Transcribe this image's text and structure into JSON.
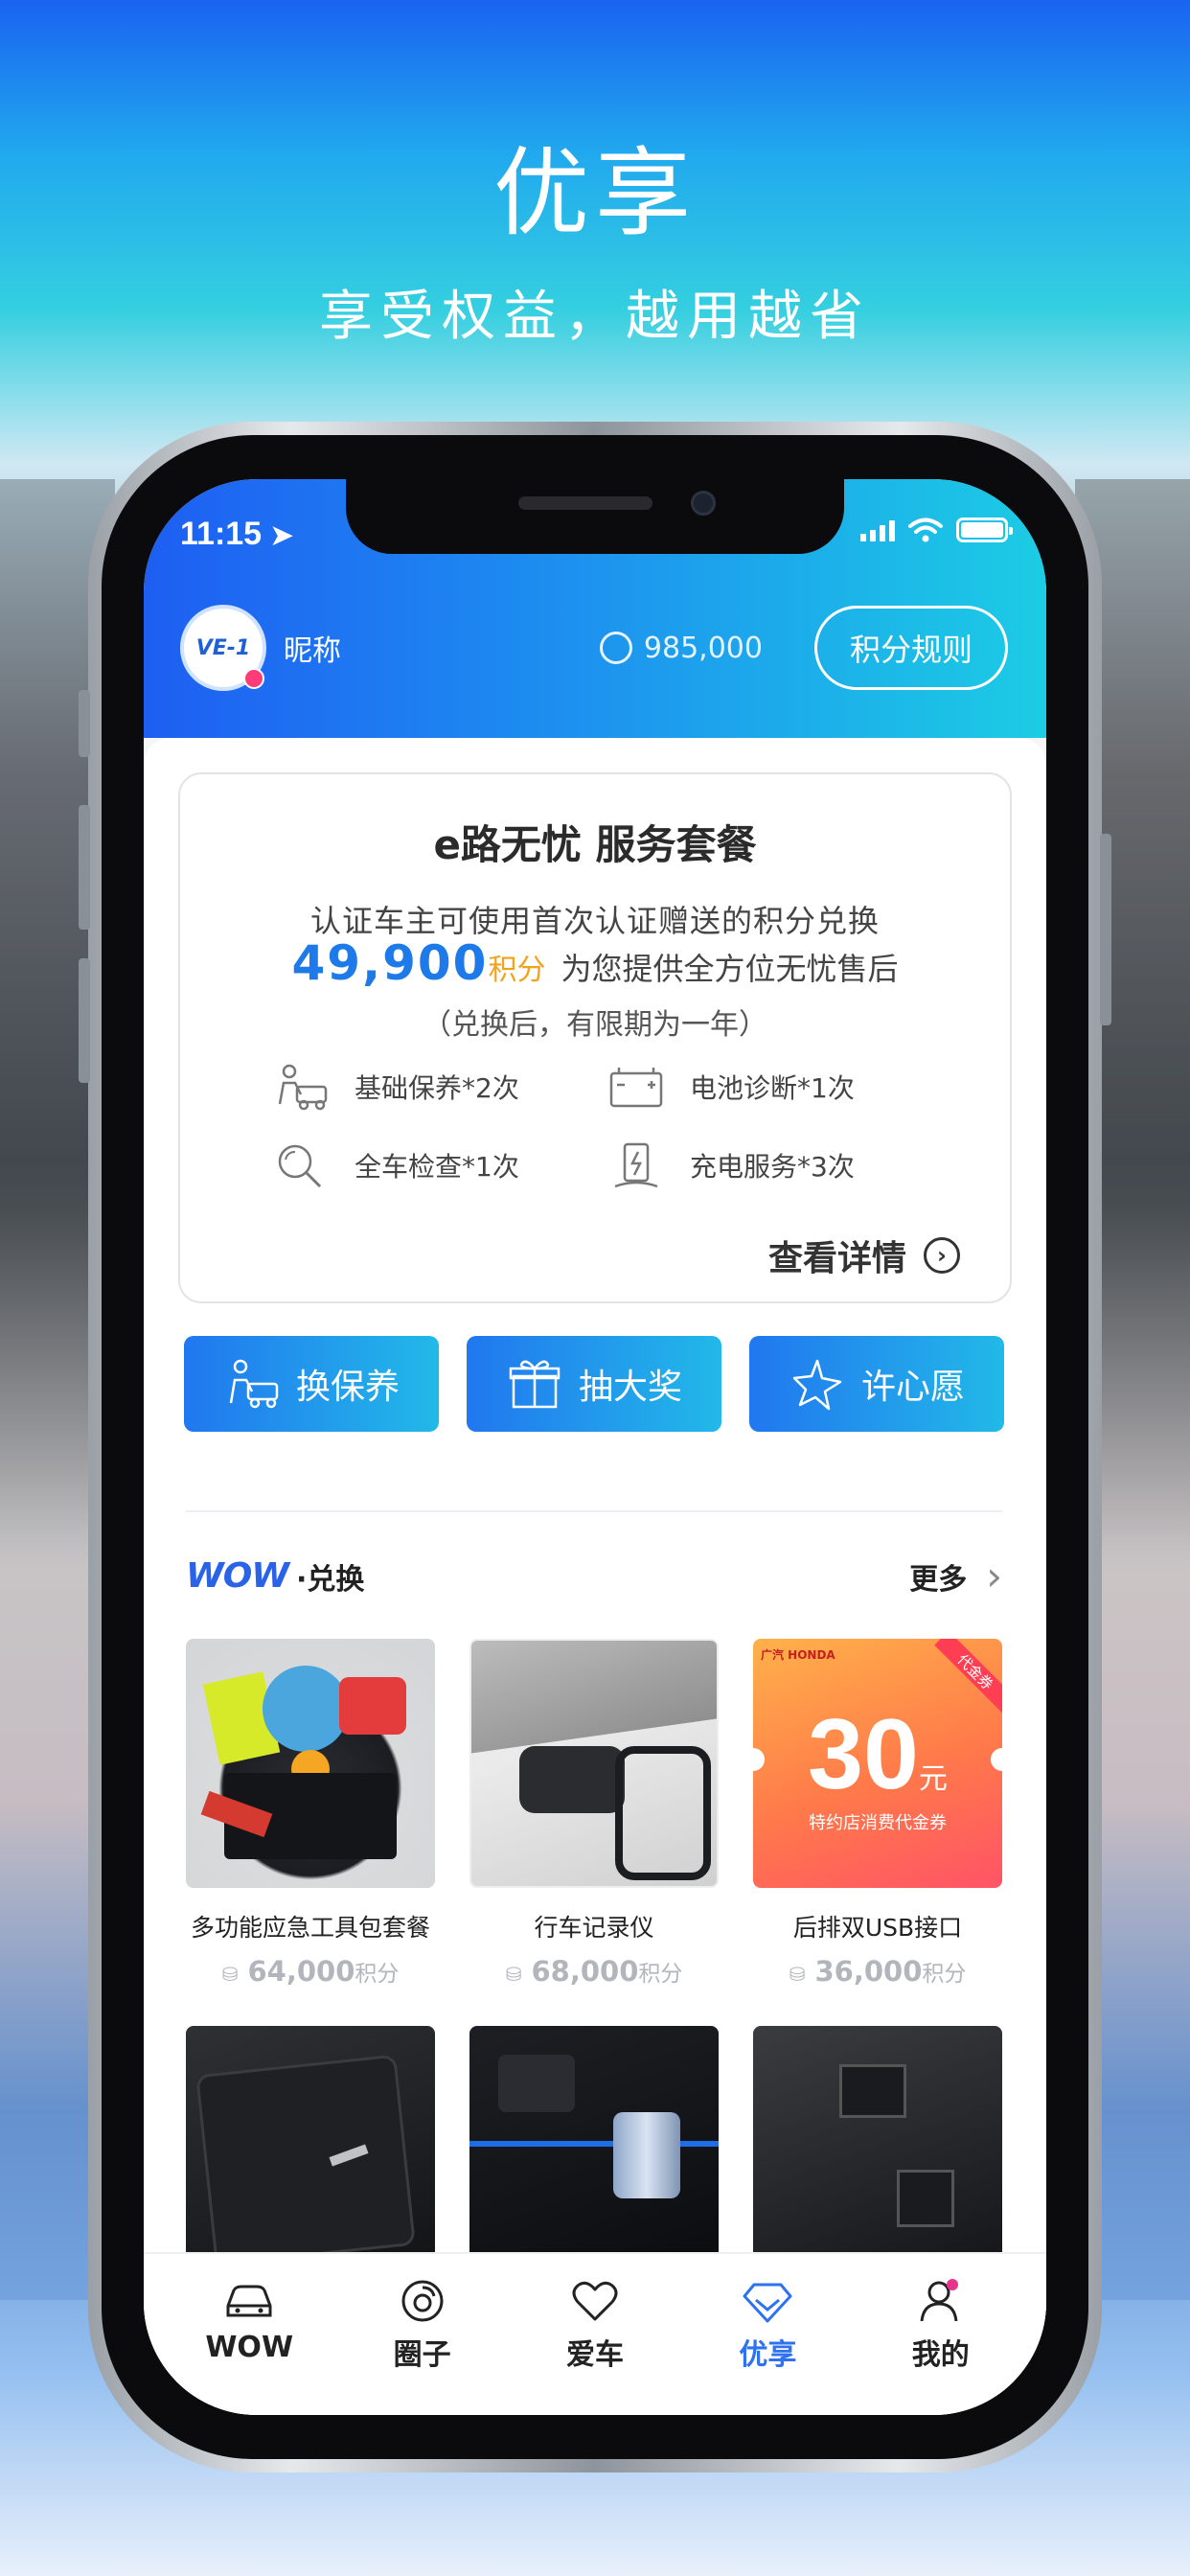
{
  "hero": {
    "title": "优享",
    "subtitle": "享受权益，越用越省"
  },
  "status_bar": {
    "time": "11:15"
  },
  "header": {
    "avatar_text": "VE-1",
    "nickname": "昵称",
    "points": "985,000",
    "rules_button": "积分规则"
  },
  "package": {
    "title": "e路无忧 服务套餐",
    "line1": "认证车主可使用首次认证赠送的积分兑换",
    "points": "49,900",
    "points_unit": "积分",
    "line2_rest": "为您提供全方位无忧售后",
    "line3": "（兑换后，有限期为一年）",
    "services": [
      {
        "icon": "car-maintenance-icon",
        "label": "基础保养*2次"
      },
      {
        "icon": "battery-icon",
        "label": "电池诊断*1次"
      },
      {
        "icon": "magnifier-icon",
        "label": "全车检查*1次"
      },
      {
        "icon": "charging-icon",
        "label": "充电服务*3次"
      }
    ],
    "detail_link": "查看详情"
  },
  "actions": [
    {
      "icon": "car-maintenance-icon",
      "label": "换保养"
    },
    {
      "icon": "gift-icon",
      "label": "抽大奖"
    },
    {
      "icon": "sparkle-icon",
      "label": "许心愿"
    }
  ],
  "wow_section": {
    "logo": "WOW",
    "title": "·兑换",
    "more": "更多"
  },
  "products": [
    {
      "name": "多功能应急工具包套餐",
      "price": "64,000",
      "unit": "积分"
    },
    {
      "name": "行车记录仪",
      "price": "68,000",
      "unit": "积分"
    },
    {
      "name": "后排双USB接口",
      "price": "36,000",
      "unit": "积分"
    },
    {
      "name": "",
      "price": "",
      "unit": ""
    },
    {
      "name": "",
      "price": "",
      "unit": ""
    },
    {
      "name": "",
      "price": "",
      "unit": ""
    }
  ],
  "voucher": {
    "brand": "广汽 HONDA",
    "tag": "代金券",
    "amount": "30",
    "currency": "元",
    "desc": "特约店消费代金券"
  },
  "tabs": [
    {
      "label": "WOW",
      "icon": "car-icon",
      "active": false
    },
    {
      "label": "圈子",
      "icon": "circle-icon",
      "active": false
    },
    {
      "label": "爱车",
      "icon": "heart-icon",
      "active": false
    },
    {
      "label": "优享",
      "icon": "diamond-icon",
      "active": true
    },
    {
      "label": "我的",
      "icon": "profile-icon",
      "active": false
    }
  ],
  "colors": {
    "primary": "#2f72f0",
    "accent_cyan": "#1ccce4",
    "points_orange": "#f3a21b",
    "voucher_red": "#ff5366"
  }
}
